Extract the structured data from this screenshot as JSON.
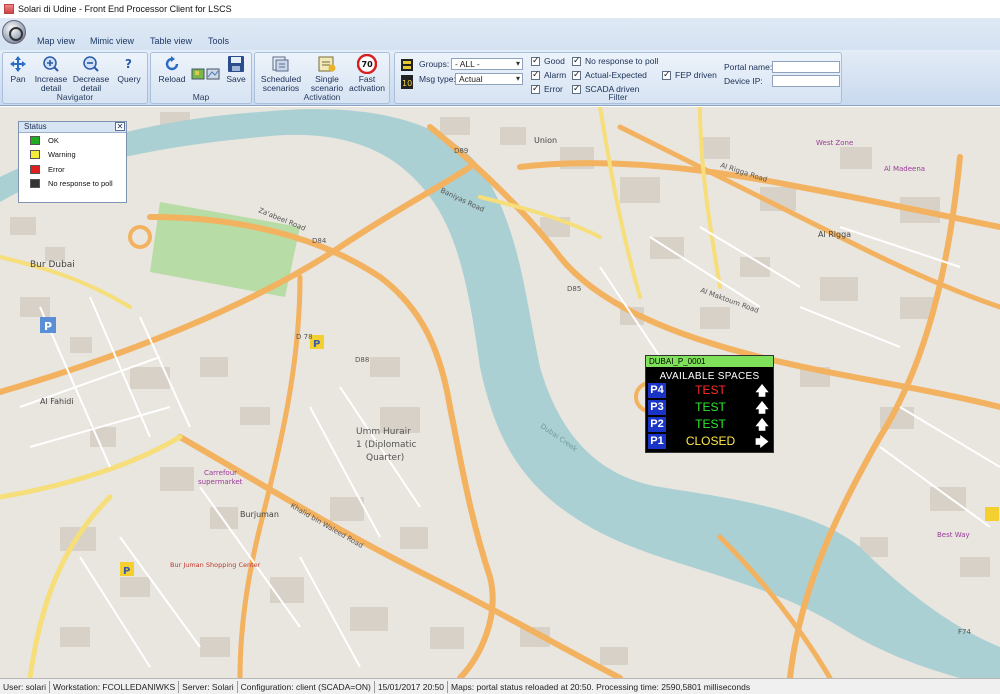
{
  "window": {
    "title": "Solari di Udine  - Front End Processor Client for LSCS"
  },
  "ribbon": {
    "tabs": [
      "Map view",
      "Mimic view",
      "Table view",
      "Tools"
    ],
    "navigator": {
      "label": "Navigator",
      "buttons": {
        "pan": "Pan",
        "increase": "Increase detail",
        "decrease": "Decrease detail",
        "query": "Query"
      }
    },
    "map": {
      "label": "Map",
      "buttons": {
        "reload": "Reload",
        "save": "Save"
      }
    },
    "activation": {
      "label": "Activation",
      "buttons": {
        "scheduled": "Scheduled scenarios",
        "single": "Single scenario",
        "fast": "Fast activation"
      },
      "fast_badge": "70"
    },
    "filter": {
      "label": "Filter",
      "groups_label": "Groups:",
      "groups_value": "- ALL -",
      "msgtype_label": "Msg type:",
      "msgtype_value": "Actual",
      "checks": {
        "good": "Good",
        "alarm": "Alarm",
        "error": "Error",
        "no_response": "No response to poll",
        "actual_expected": "Actual-Expected",
        "scada": "SCADA driven",
        "fep": "FEP driven"
      },
      "portal_label": "Portal name:",
      "device_label": "Device IP:",
      "portal_value": "",
      "device_value": ""
    }
  },
  "status_panel": {
    "title": "Status",
    "items": [
      {
        "label": "OK",
        "color": "#22aa22"
      },
      {
        "label": "Warning",
        "color": "#f4ec3a"
      },
      {
        "label": "Error",
        "color": "#e02020"
      },
      {
        "label": "No response to poll",
        "color": "#333333"
      }
    ]
  },
  "sign": {
    "id": "DUBAI_P_0001",
    "title": "AVAILABLE SPACES",
    "rows": [
      {
        "level": "P4",
        "value": "TEST",
        "color": "#ff2a2a",
        "arrow": "🡅"
      },
      {
        "level": "P3",
        "value": "TEST",
        "color": "#2ee82e",
        "arrow": "🡅"
      },
      {
        "level": "P2",
        "value": "TEST",
        "color": "#2ee82e",
        "arrow": "🡅"
      },
      {
        "level": "P1",
        "value": "CLOSED",
        "color": "#ffe94a",
        "arrow": "🡆"
      }
    ]
  },
  "map_labels": {
    "bur_dubai": "Bur Dubai",
    "al_fahidi": "Al Fahidi",
    "umm_hurair": "Umm Hurair",
    "diplomatic": "1 (Diplomatic",
    "quarter": "Quarter)",
    "burjuman": "Burjuman",
    "al_rigga": "Al Rigga",
    "union": "Union",
    "west_zone": "West Zone",
    "carrefour": "Carrefour",
    "supermarket": "supermarket",
    "al_madeena": "Al Madeena",
    "best_way": "Best Way",
    "bur_juman_center": "Bur Juman Shopping Center",
    "za_abeel_road": "Za'abeel Road",
    "baniyas_road": "Baniyas Road",
    "al_maktoum_road": "Al Maktoum Road",
    "al_rigga_road": "Al Rigga Road",
    "khalid_bin_waleed": "Khalid bin Waleed Road",
    "d84": "D84",
    "d85": "D85",
    "d88": "D88",
    "d89": "D89",
    "d78": "D 78",
    "f74": "F74",
    "creek": "Dubai Creek"
  },
  "statusbar": {
    "user": "User: solari",
    "workstation": "Workstation: FCOLLEDANIWKS",
    "server": "Server: Solari",
    "config": "Configuration: client (SCADA=ON)",
    "datetime": "15/01/2017 20:50",
    "maps": "Maps: portal status reloaded at 20:50. Processing time: 2590,5801 milliseconds"
  }
}
